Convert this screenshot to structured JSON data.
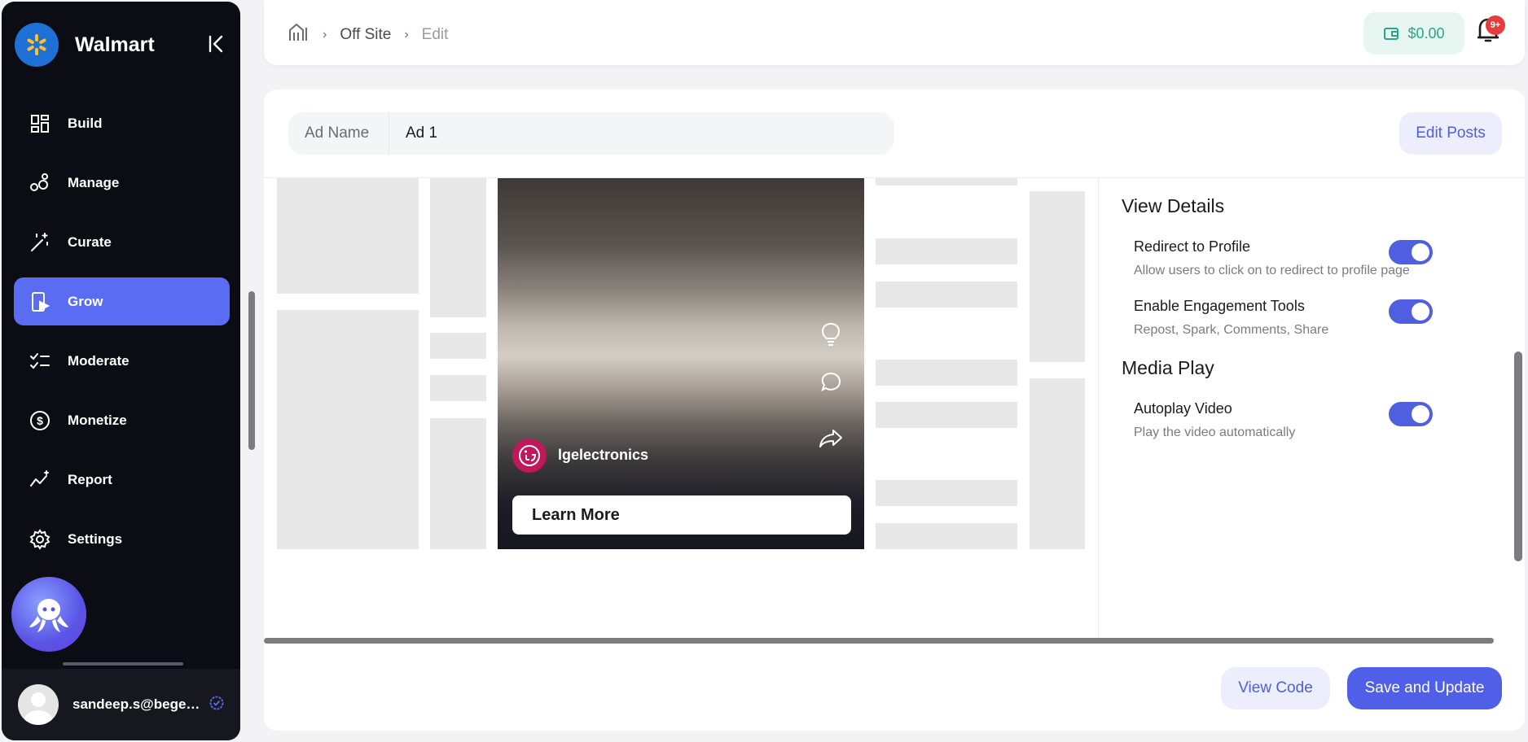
{
  "sidebar": {
    "brand": "Walmart",
    "nav": [
      {
        "label": "Build",
        "icon": "grid-layout-icon"
      },
      {
        "label": "Manage",
        "icon": "bubbles-icon"
      },
      {
        "label": "Curate",
        "icon": "magic-wand-icon"
      },
      {
        "label": "Grow",
        "icon": "play-device-icon",
        "active": true
      },
      {
        "label": "Moderate",
        "icon": "checklist-icon"
      },
      {
        "label": "Monetize",
        "icon": "dollar-circle-icon"
      },
      {
        "label": "Report",
        "icon": "sparkline-icon"
      },
      {
        "label": "Settings",
        "icon": "gear-icon"
      }
    ],
    "user_email": "sandeep.s@begenuin.com"
  },
  "topbar": {
    "breadcrumb": [
      "Off Site",
      "Edit"
    ],
    "wallet": "$0.00",
    "notification_badge": "9+"
  },
  "editor": {
    "ad_name_label": "Ad Name",
    "ad_name_value": "Ad 1",
    "edit_posts": "Edit Posts"
  },
  "preview": {
    "account_name": "lgelectronics",
    "cta": "Learn More"
  },
  "settings": {
    "view_details_title": "View Details",
    "redirect_title": "Redirect to Profile",
    "redirect_desc": "Allow users to click on to redirect to profile page",
    "redirect_on": true,
    "engagement_title": "Enable Engagement Tools",
    "engagement_desc": "Repost, Spark, Comments, Share",
    "engagement_on": true,
    "media_play_title": "Media Play",
    "autoplay_title": "Autoplay Video",
    "autoplay_desc": "Play the video automatically",
    "autoplay_on": true
  },
  "footer": {
    "view_code": "View Code",
    "save_update": "Save and Update"
  },
  "colors": {
    "sidebar_bg": "#0b0c14",
    "accent": "#4f5fe8",
    "wallet_green": "#28a58a",
    "badge_red": "#e53d3d"
  }
}
